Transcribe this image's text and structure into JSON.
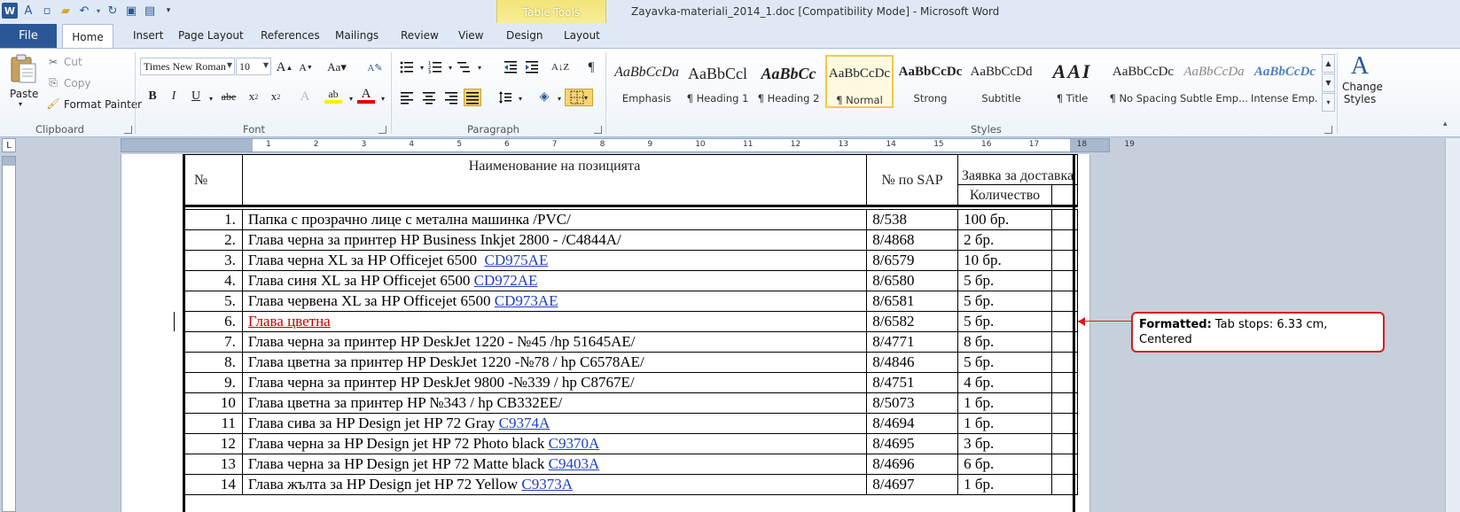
{
  "window": {
    "title": "Zayavka-materiali_2014_1.doc [Compatibility Mode]  -  Microsoft Word",
    "contextual_tab_group": "Table Tools"
  },
  "tabs": {
    "file": "File",
    "home": "Home",
    "insert": "Insert",
    "page_layout": "Page Layout",
    "references": "References",
    "mailings": "Mailings",
    "review": "Review",
    "view": "View",
    "design": "Design",
    "layout": "Layout"
  },
  "clipboard": {
    "group": "Clipboard",
    "paste": "Paste",
    "cut": "Cut",
    "copy": "Copy",
    "format_painter": "Format Painter"
  },
  "font": {
    "group": "Font",
    "font_name": "Times New Roman",
    "font_size": "10"
  },
  "paragraph": {
    "group": "Paragraph"
  },
  "styles": {
    "group": "Styles",
    "change_styles": "Change Styles",
    "items": [
      {
        "sample": "AaBbCcDa",
        "name": "Emphasis"
      },
      {
        "sample": "AaBbCcl",
        "name": "¶ Heading 1"
      },
      {
        "sample": "AaBbCc",
        "name": "¶ Heading 2"
      },
      {
        "sample": "AaBbCcDc",
        "name": "¶ Normal"
      },
      {
        "sample": "AaBbCcDc",
        "name": "Strong"
      },
      {
        "sample": "AaBbCcDd",
        "name": "Subtitle"
      },
      {
        "sample": "AAI",
        "name": "¶ Title"
      },
      {
        "sample": "AaBbCcDc",
        "name": "¶ No Spacing"
      },
      {
        "sample": "AaBbCcDa",
        "name": "Subtle Emp..."
      },
      {
        "sample": "AaBbCcDc",
        "name": "Intense Emp..."
      }
    ]
  },
  "ruler": {
    "numbers": [
      "1",
      "2",
      "3",
      "4",
      "5",
      "6",
      "7",
      "8",
      "9",
      "10",
      "11",
      "12",
      "13",
      "14",
      "15",
      "16",
      "17",
      "18",
      "19"
    ]
  },
  "table": {
    "headers": {
      "num": "№",
      "name": "Наименование на позицията",
      "sap": "№ по SAP",
      "order": "Заявка за доставка",
      "qty": "Количество"
    },
    "rows": [
      {
        "num": "1.",
        "name": "Папка с прозрачно лице с метална машинка /PVC/",
        "link": "",
        "sap": "8/538",
        "qty": "100 бр."
      },
      {
        "num": "2.",
        "name": "Глава черна за принтер HP Business Inkjet 2800 - /C4844A/",
        "link": "",
        "sap": "8/4868",
        "qty": "2 бр."
      },
      {
        "num": "3.",
        "name": "Глава черна XL за HP Officejet 6500  ",
        "link": "CD975AE",
        "sap": "8/6579",
        "qty": "10 бр."
      },
      {
        "num": "4.",
        "name": "Глава синя XL за HP Officejet 6500 ",
        "link": "CD972AE",
        "sap": "8/6580",
        "qty": "5 бр."
      },
      {
        "num": "5.",
        "name": "Глава червена XL за HP Officejet 6500 ",
        "link": "CD973AE",
        "sap": "8/6581",
        "qty": "5 бр."
      },
      {
        "num": "6.",
        "name": "Глава цветна",
        "link": "",
        "sap": "8/6582",
        "qty": "5 бр.",
        "tracked": true
      },
      {
        "num": "7.",
        "name": "Глава черна за принтер HP DeskJet 1220 - №45 /hp 51645AE/",
        "link": "",
        "sap": "8/4771",
        "qty": "8 бр."
      },
      {
        "num": "8.",
        "name": "Глава цветна за принтер HP DeskJet 1220 -№78 / hp C6578AE/",
        "link": "",
        "sap": "8/4846",
        "qty": "5 бр."
      },
      {
        "num": "9.",
        "name": "Глава черна за принтер HP DeskJet 9800 -№339 / hp C8767E/",
        "link": "",
        "sap": "8/4751",
        "qty": "4 бр."
      },
      {
        "num": "10",
        "name": "Глава цветна за принтер HP №343 / hp CB332EE/",
        "link": "",
        "sap": "8/5073",
        "qty": "1 бр."
      },
      {
        "num": "11",
        "name": "Глава сива за HP Design jet HP 72 Gray ",
        "link": "C9374A",
        "sap": "8/4694",
        "qty": "1 бр."
      },
      {
        "num": "12",
        "name": "Глава черна за HP Design jet HP 72 Photo black ",
        "link": "C9370A",
        "sap": "8/4695",
        "qty": "3 бр."
      },
      {
        "num": "13",
        "name": "Глава черна за HP Design jet HP 72 Matte black ",
        "link": "C9403A",
        "sap": "8/4696",
        "qty": "6 бр."
      },
      {
        "num": "14",
        "name": "Глава жълта за HP Design jet HP 72 Yellow ",
        "link": "C9373A",
        "sap": "8/4697",
        "qty": "1 бр."
      }
    ]
  },
  "comment": {
    "label": "Formatted:",
    "text": " Tab stops:  6.33 cm, Centered"
  },
  "colors": {
    "file_tab": "#2b5797",
    "table_tools": "#f3e47a",
    "link": "#1f3fc1",
    "tracked_change": "#c00000",
    "balloon_border": "#d11f1f"
  }
}
